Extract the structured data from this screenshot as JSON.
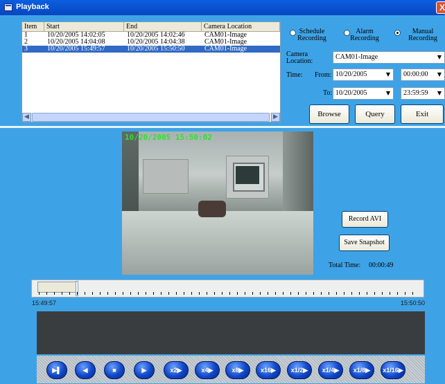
{
  "window": {
    "title": "Playback",
    "close_label": "X"
  },
  "list": {
    "columns": [
      "Item",
      "Start",
      "End",
      "Camera Location"
    ],
    "rows": [
      {
        "item": "1",
        "start": "10/20/2005 14:02:05",
        "end": "10/20/2005 14:02:46",
        "camera": "CAM01-Image"
      },
      {
        "item": "2",
        "start": "10/20/2005 14:04:08",
        "end": "10/20/2005 14:04:38",
        "camera": "CAM01-Image"
      },
      {
        "item": "3",
        "start": "10/20/2005 15:49:57",
        "end": "10/20/2005 15:50:50",
        "camera": "CAM01-Image"
      }
    ],
    "selected_index": 2
  },
  "recording": {
    "schedule_line1": "Schedule",
    "schedule_line2": "Recording",
    "alarm_line1": "Alarm",
    "alarm_line2": "Recording",
    "manual_line1": "Manual",
    "manual_line2": "Recording",
    "selected": "manual"
  },
  "filters": {
    "camera_label_line1": "Camera",
    "camera_label_line2": "Location:",
    "camera_value": "CAM01-Image",
    "time_label": "Time:",
    "from_label": "From:",
    "to_label": "To:",
    "from_date": "10/20/2005",
    "from_time": "00:00:00",
    "to_date": "10/20/2005",
    "to_time": "23:59:59"
  },
  "buttons": {
    "browse": "Browse",
    "query": "Query",
    "exit": "Exit",
    "record_avi": "Record AVI",
    "save_snapshot": "Save Snapshot"
  },
  "video": {
    "timestamp": "10/20/2005 15:50:02"
  },
  "total_time": {
    "label": "Total Time:",
    "value": "00:00:49"
  },
  "timeline": {
    "start": "15:49:57",
    "end": "15:50:50",
    "position": 0.1
  },
  "controls": [
    {
      "label": "▶▌",
      "name": "step-play-button",
      "round": true
    },
    {
      "label": "◀",
      "name": "reverse-button",
      "round": true
    },
    {
      "label": "■",
      "name": "stop-button",
      "round": true
    },
    {
      "label": "▶",
      "name": "play-button",
      "round": true
    },
    {
      "label": "x2▶",
      "name": "speed-x2-button"
    },
    {
      "label": "x4▶",
      "name": "speed-x4-button"
    },
    {
      "label": "x8▶",
      "name": "speed-x8-button"
    },
    {
      "label": "x16▶",
      "name": "speed-x16-button"
    },
    {
      "label": "x1/2▶",
      "name": "speed-x1-2-button"
    },
    {
      "label": "x1/4▶",
      "name": "speed-x1-4-button"
    },
    {
      "label": "x1/8▶",
      "name": "speed-x1-8-button"
    },
    {
      "label": "x1/16▶",
      "name": "speed-x1-16-button"
    }
  ]
}
